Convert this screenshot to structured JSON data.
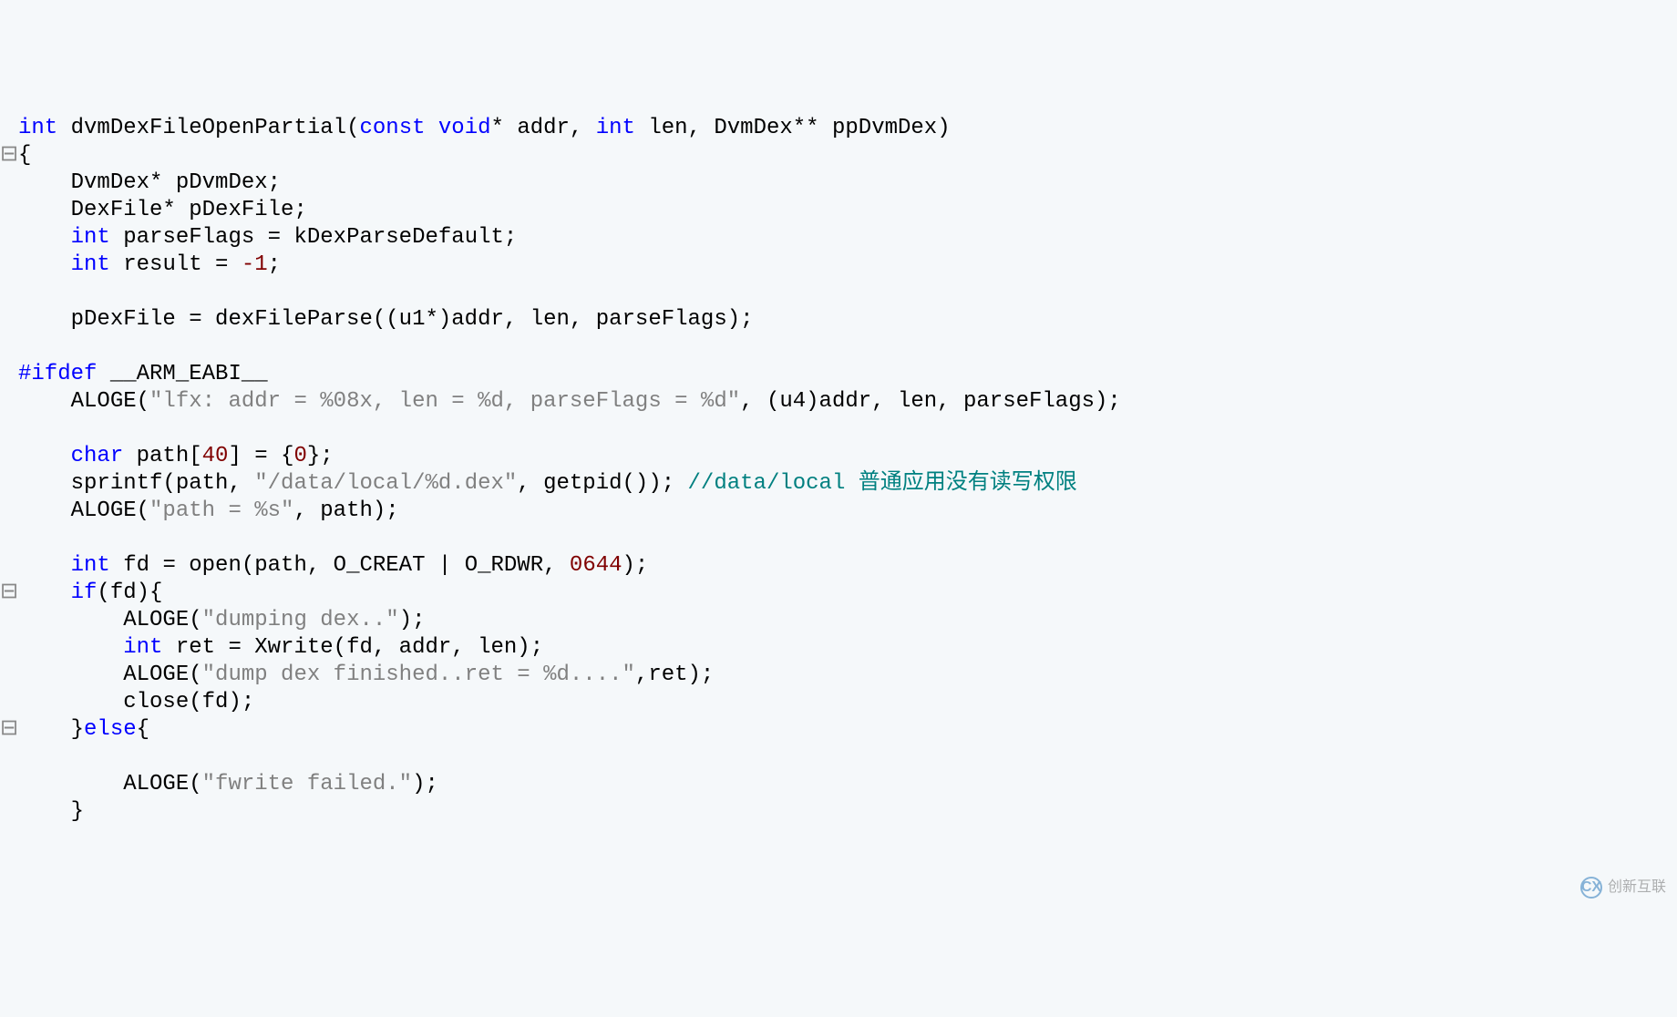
{
  "code": {
    "lines": [
      {
        "gutter": "",
        "tokens": [
          {
            "t": "kw",
            "v": "int"
          },
          {
            "t": "ident",
            "v": " dvmDexFileOpenPartial"
          },
          {
            "t": "punct",
            "v": "("
          },
          {
            "t": "kw",
            "v": "const"
          },
          {
            "t": "ident",
            "v": " "
          },
          {
            "t": "kw",
            "v": "void"
          },
          {
            "t": "punct",
            "v": "* addr, "
          },
          {
            "t": "kw",
            "v": "int"
          },
          {
            "t": "ident",
            "v": " len, DvmDex** ppDvmDex"
          },
          {
            "t": "punct",
            "v": ")"
          }
        ]
      },
      {
        "gutter": "⊟",
        "tokens": [
          {
            "t": "punct",
            "v": "{"
          }
        ]
      },
      {
        "gutter": "",
        "tokens": [
          {
            "t": "ident",
            "v": "    DvmDex* pDvmDex;"
          }
        ]
      },
      {
        "gutter": "",
        "tokens": [
          {
            "t": "ident",
            "v": "    DexFile* pDexFile;"
          }
        ]
      },
      {
        "gutter": "",
        "tokens": [
          {
            "t": "ident",
            "v": "    "
          },
          {
            "t": "kw",
            "v": "int"
          },
          {
            "t": "ident",
            "v": " parseFlags = kDexParseDefault;"
          }
        ]
      },
      {
        "gutter": "",
        "tokens": [
          {
            "t": "ident",
            "v": "    "
          },
          {
            "t": "kw",
            "v": "int"
          },
          {
            "t": "ident",
            "v": " result = "
          },
          {
            "t": "num",
            "v": "-1"
          },
          {
            "t": "punct",
            "v": ";"
          }
        ]
      },
      {
        "gutter": "",
        "tokens": [
          {
            "t": "ident",
            "v": ""
          }
        ]
      },
      {
        "gutter": "",
        "tokens": [
          {
            "t": "ident",
            "v": "    pDexFile = dexFileParse((u1*)addr, len, parseFlags);"
          }
        ]
      },
      {
        "gutter": "",
        "tokens": [
          {
            "t": "ident",
            "v": ""
          }
        ]
      },
      {
        "gutter": "",
        "tokens": [
          {
            "t": "preproc",
            "v": "#ifdef"
          },
          {
            "t": "ident",
            "v": " __ARM_EABI__"
          }
        ]
      },
      {
        "gutter": "",
        "tokens": [
          {
            "t": "ident",
            "v": "    ALOGE("
          },
          {
            "t": "str",
            "v": "\"lfx: addr = %08x, len = %d, parseFlags = %d\""
          },
          {
            "t": "ident",
            "v": ", (u4)addr, len, parseFlags);"
          }
        ]
      },
      {
        "gutter": "",
        "tokens": [
          {
            "t": "ident",
            "v": ""
          }
        ]
      },
      {
        "gutter": "",
        "tokens": [
          {
            "t": "ident",
            "v": "    "
          },
          {
            "t": "kw",
            "v": "char"
          },
          {
            "t": "ident",
            "v": " path["
          },
          {
            "t": "num",
            "v": "40"
          },
          {
            "t": "ident",
            "v": "] = {"
          },
          {
            "t": "num",
            "v": "0"
          },
          {
            "t": "ident",
            "v": "};"
          }
        ]
      },
      {
        "gutter": "",
        "tokens": [
          {
            "t": "ident",
            "v": "    sprintf(path, "
          },
          {
            "t": "str",
            "v": "\"/data/local/%d.dex\""
          },
          {
            "t": "ident",
            "v": ", getpid()); "
          },
          {
            "t": "comment",
            "v": "//data/local 普通应用没有读写权限"
          }
        ]
      },
      {
        "gutter": "",
        "tokens": [
          {
            "t": "ident",
            "v": "    ALOGE("
          },
          {
            "t": "str",
            "v": "\"path = %s\""
          },
          {
            "t": "ident",
            "v": ", path);"
          }
        ]
      },
      {
        "gutter": "",
        "tokens": [
          {
            "t": "ident",
            "v": ""
          }
        ]
      },
      {
        "gutter": "",
        "tokens": [
          {
            "t": "ident",
            "v": "    "
          },
          {
            "t": "kw",
            "v": "int"
          },
          {
            "t": "ident",
            "v": " fd = open(path, O_CREAT | O_RDWR, "
          },
          {
            "t": "num",
            "v": "0644"
          },
          {
            "t": "ident",
            "v": ");"
          }
        ]
      },
      {
        "gutter": "⊟",
        "tokens": [
          {
            "t": "ident",
            "v": "    "
          },
          {
            "t": "kw",
            "v": "if"
          },
          {
            "t": "ident",
            "v": "(fd){"
          }
        ]
      },
      {
        "gutter": "",
        "tokens": [
          {
            "t": "ident",
            "v": "        ALOGE("
          },
          {
            "t": "str",
            "v": "\"dumping dex..\""
          },
          {
            "t": "ident",
            "v": ");"
          }
        ]
      },
      {
        "gutter": "",
        "tokens": [
          {
            "t": "ident",
            "v": "        "
          },
          {
            "t": "kw",
            "v": "int"
          },
          {
            "t": "ident",
            "v": " ret = Xwrite(fd, addr, len);"
          }
        ]
      },
      {
        "gutter": "",
        "tokens": [
          {
            "t": "ident",
            "v": "        ALOGE("
          },
          {
            "t": "str",
            "v": "\"dump dex finished..ret = %d....\""
          },
          {
            "t": "ident",
            "v": ",ret);"
          }
        ]
      },
      {
        "gutter": "",
        "tokens": [
          {
            "t": "ident",
            "v": "        close(fd);"
          }
        ]
      },
      {
        "gutter": "⊟",
        "tokens": [
          {
            "t": "ident",
            "v": "    }"
          },
          {
            "t": "kw",
            "v": "else"
          },
          {
            "t": "ident",
            "v": "{"
          }
        ]
      },
      {
        "gutter": "",
        "tokens": [
          {
            "t": "ident",
            "v": ""
          }
        ]
      },
      {
        "gutter": "",
        "tokens": [
          {
            "t": "ident",
            "v": "        ALOGE("
          },
          {
            "t": "str",
            "v": "\"fwrite failed.\""
          },
          {
            "t": "ident",
            "v": ");"
          }
        ]
      },
      {
        "gutter": "",
        "tokens": [
          {
            "t": "ident",
            "v": "    }"
          }
        ]
      }
    ]
  },
  "watermark": {
    "icon_text": "CX",
    "text": "创新互联"
  }
}
